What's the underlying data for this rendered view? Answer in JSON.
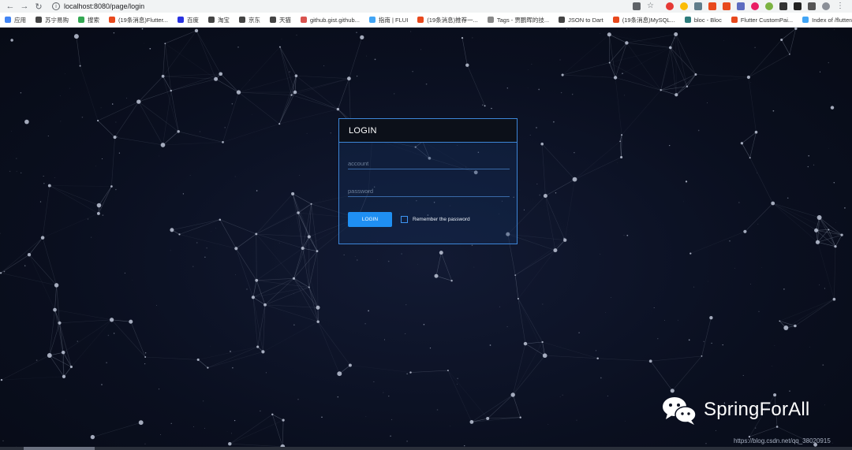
{
  "browser": {
    "url": "localhost:8080/page/login",
    "back_icon": "arrow-left-icon",
    "forward_icon": "arrow-right-icon",
    "reload_icon": "reload-icon",
    "bookmarks": [
      {
        "label": "应用",
        "color": "#4285f4"
      },
      {
        "label": "苏宁易购",
        "color": "#444444"
      },
      {
        "label": "搜索",
        "color": "#34a853"
      },
      {
        "label": "(19条消息)Flutter...",
        "color": "#e8491d"
      },
      {
        "label": "百度",
        "color": "#2932e1"
      },
      {
        "label": "淘宝",
        "color": "#444444"
      },
      {
        "label": "京东",
        "color": "#444444"
      },
      {
        "label": "天猫",
        "color": "#444444"
      },
      {
        "label": "github.gist.github...",
        "color": "#d9534f"
      },
      {
        "label": "指南 | FLUI",
        "color": "#42a5f5"
      },
      {
        "label": "(19条消息)推荐一...",
        "color": "#e8491d"
      },
      {
        "label": "Tags - 贾鹏晖的技...",
        "color": "#888888"
      },
      {
        "label": "JSON to Dart",
        "color": "#444444"
      },
      {
        "label": "(19条消息)MySQL...",
        "color": "#e8491d"
      },
      {
        "label": "bloc - Bloc",
        "color": "#2e7d7d"
      },
      {
        "label": "Flutter CustomPai...",
        "color": "#e8491d"
      },
      {
        "label": "Index of /flutter/fl...",
        "color": "#42a5f5"
      }
    ],
    "bookmarks_more": "»"
  },
  "login": {
    "title": "LOGIN",
    "account_placeholder": "account",
    "password_placeholder": "password",
    "button_label": "LOGIN",
    "remember_label": "Remember the password"
  },
  "watermark": {
    "brand": "SpringForAll",
    "url": "https://blog.csdn.net/qq_38020915"
  },
  "colors": {
    "accent": "#1f8ff2",
    "panel_border": "#3d86d8",
    "background": "#0b1020"
  }
}
